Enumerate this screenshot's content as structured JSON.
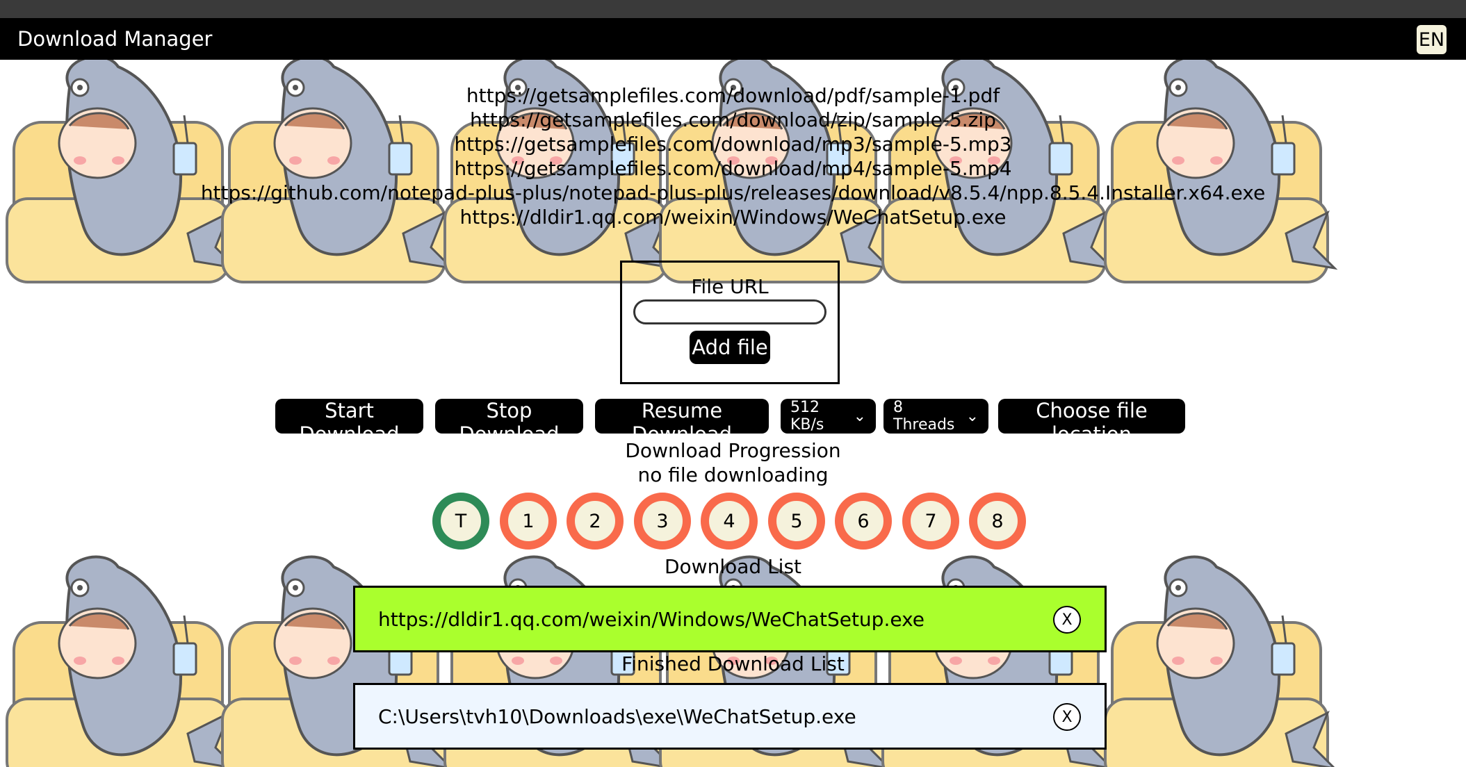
{
  "header": {
    "title": "Download Manager",
    "language": "EN"
  },
  "sample_urls": [
    "https://getsamplefiles.com/download/pdf/sample-1.pdf",
    "https://getsamplefiles.com/download/zip/sample-5.zip",
    "https://getsamplefiles.com/download/mp3/sample-5.mp3",
    "https://getsamplefiles.com/download/mp4/sample-5.mp4",
    "https://github.com/notepad-plus-plus/notepad-plus-plus/releases/download/v8.5.4/npp.8.5.4.Installer.x64.exe",
    "https://dldir1.qq.com/weixin/Windows/WeChatSetup.exe"
  ],
  "add_file": {
    "label": "File URL",
    "input_value": "",
    "button": "Add file"
  },
  "controls": {
    "start": "Start Download",
    "stop": "Stop Download",
    "resume": "Resume Download",
    "speed": "512 KB/s",
    "threads": "8 Threads",
    "location": "Choose file location"
  },
  "progress": {
    "title": "Download Progression",
    "status": "no file downloading",
    "indicators": [
      "T",
      "1",
      "2",
      "3",
      "4",
      "5",
      "6",
      "7",
      "8"
    ]
  },
  "download_list": {
    "title": "Download List",
    "items": [
      {
        "url": "https://dldir1.qq.com/weixin/Windows/WeChatSetup.exe",
        "remove": "X"
      }
    ]
  },
  "finished_list": {
    "title": "Finished Download List",
    "items": [
      {
        "path": "C:\\Users\\tvh10\\Downloads\\exe\\WeChatSetup.exe",
        "remove": "X"
      }
    ]
  },
  "colors": {
    "active_row": "#aaff2d",
    "finished_row": "#eef6ff",
    "thread_ring": "#f96a4b",
    "total_ring": "#2e8b57"
  }
}
